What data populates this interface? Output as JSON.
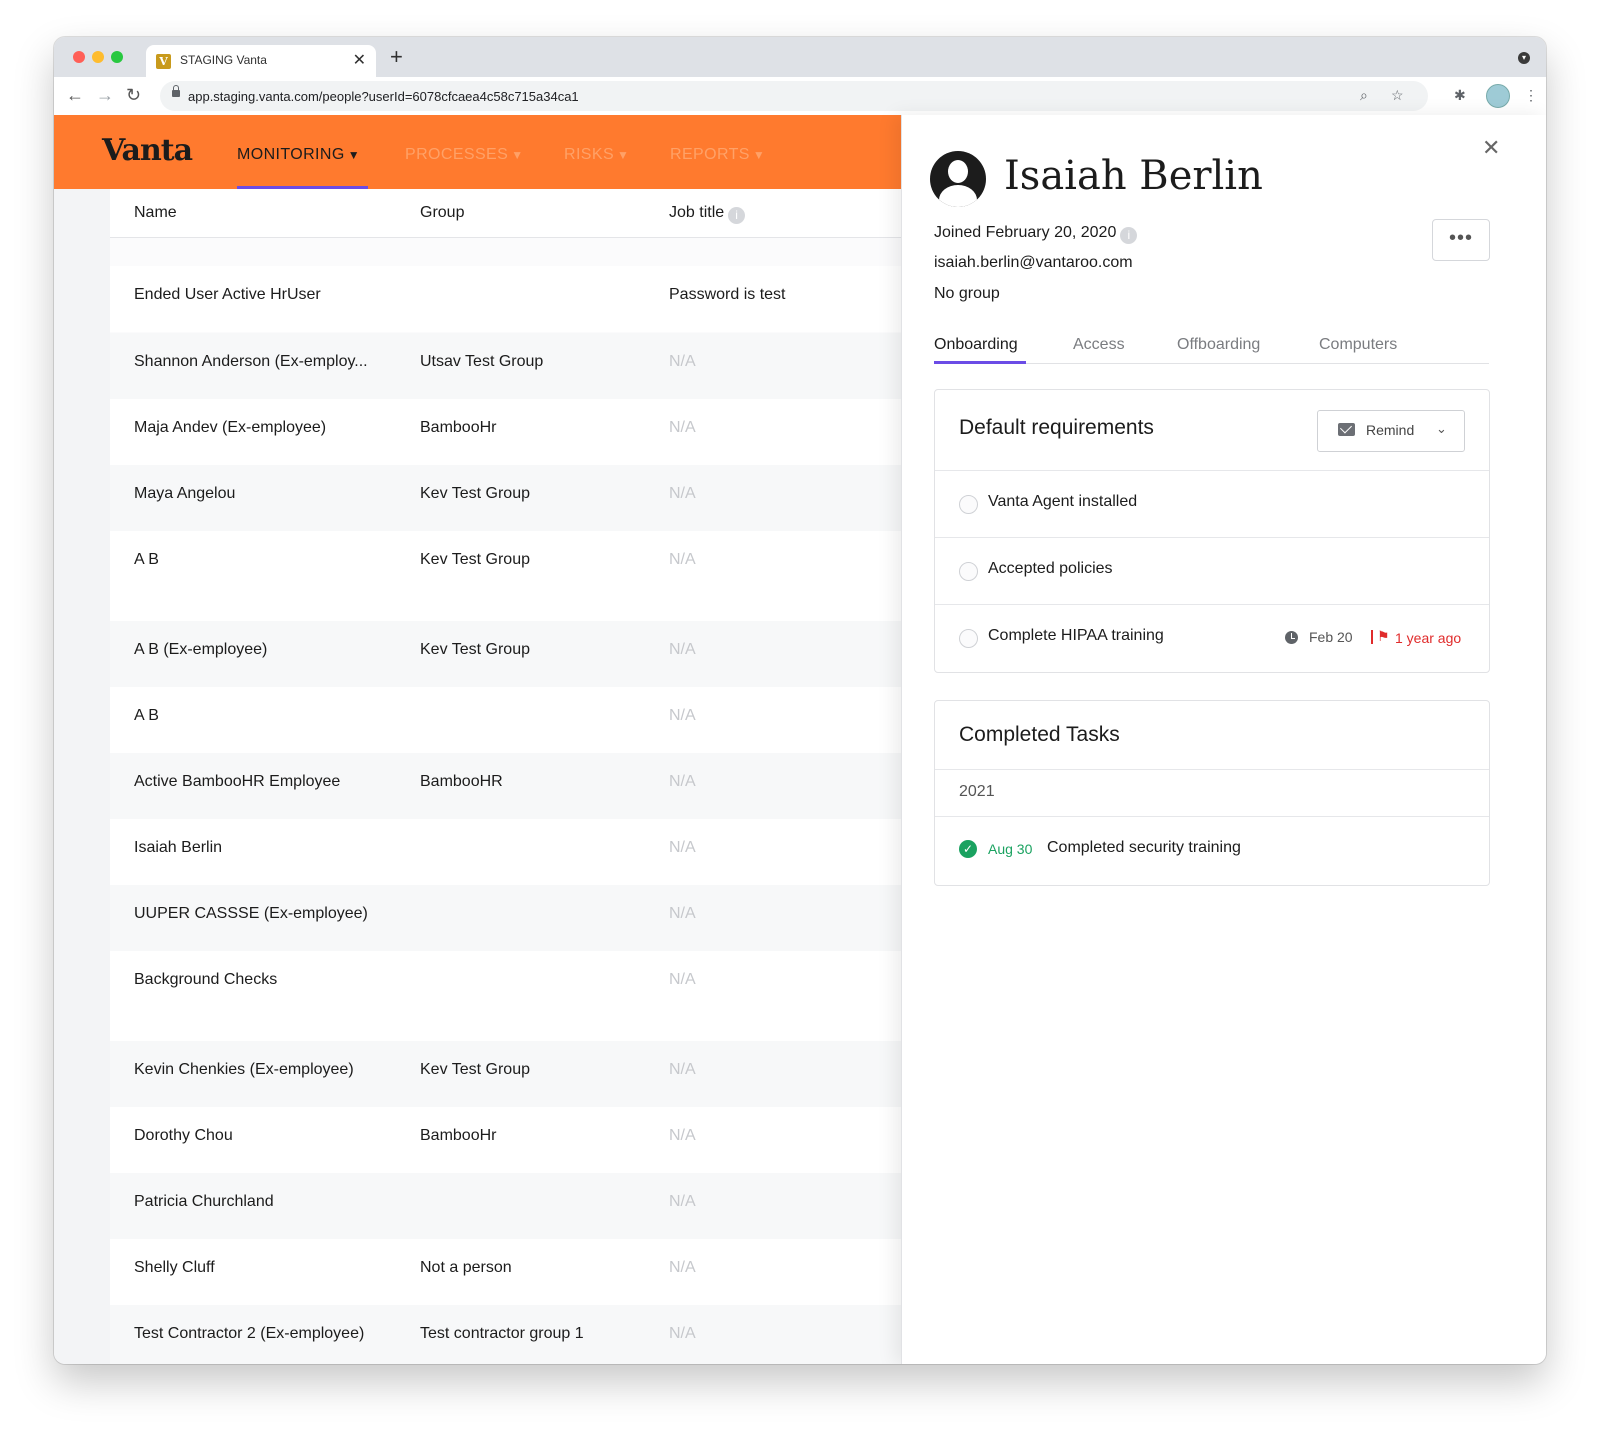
{
  "browser": {
    "tab_title": "STAGING Vanta",
    "favicon_letter": "V",
    "url": "app.staging.vanta.com/people?userId=6078cfcaea4c58c715a34ca1",
    "traffic_lights": [
      "#ff5f57",
      "#febc2e",
      "#28c840"
    ]
  },
  "topnav": {
    "logo": "Vanta",
    "items": [
      {
        "label": "MONITORING",
        "active": true,
        "color": "#1c1c1c"
      },
      {
        "label": "PROCESSES",
        "active": false,
        "color": "#ffa167"
      },
      {
        "label": "RISKS",
        "active": false,
        "color": "#ffa167"
      },
      {
        "label": "REPORTS",
        "active": false,
        "color": "#ffa167"
      }
    ],
    "background": "#ff7a2e",
    "accent": "#6b4ce6"
  },
  "table": {
    "headers": {
      "name": "Name",
      "group": "Group",
      "job_title": "Job title"
    },
    "rows": [
      {
        "name": "Ended User Active HrUser",
        "group": "",
        "job_title": "Password is test",
        "na": false
      },
      {
        "name": "Shannon Anderson (Ex-employ...",
        "group": "Utsav Test Group",
        "job_title": "N/A",
        "na": true
      },
      {
        "name": "Maja Andev (Ex-employee)",
        "group": "BambooHr",
        "job_title": "N/A",
        "na": true
      },
      {
        "name": "Maya Angelou",
        "group": "Kev Test Group",
        "job_title": "N/A",
        "na": true
      },
      {
        "name": "A B",
        "group": "Kev Test Group",
        "job_title": "N/A",
        "na": true
      },
      {
        "name": "A B (Ex-employee)",
        "group": "Kev Test Group",
        "job_title": "N/A",
        "na": true
      },
      {
        "name": "A B",
        "group": "",
        "job_title": "N/A",
        "na": true
      },
      {
        "name": "Active BambooHR Employee",
        "group": "BambooHR",
        "job_title": "N/A",
        "na": true
      },
      {
        "name": "Isaiah Berlin",
        "group": "",
        "job_title": "N/A",
        "na": true
      },
      {
        "name": "UUPER CASSSE (Ex-employee)",
        "group": "",
        "job_title": "N/A",
        "na": true
      },
      {
        "name": "Background Checks",
        "group": "",
        "job_title": "N/A",
        "na": true
      },
      {
        "name": "Kevin Chenkies (Ex-employee)",
        "group": "Kev Test Group",
        "job_title": "N/A",
        "na": true
      },
      {
        "name": "Dorothy Chou",
        "group": "BambooHr",
        "job_title": "N/A",
        "na": true
      },
      {
        "name": "Patricia Churchland",
        "group": "",
        "job_title": "N/A",
        "na": true
      },
      {
        "name": "Shelly Cluff",
        "group": "Not a person",
        "job_title": "N/A",
        "na": true
      },
      {
        "name": "Test Contractor 2 (Ex-employee)",
        "group": "Test contractor group 1",
        "job_title": "N/A",
        "na": true
      }
    ]
  },
  "panel": {
    "name": "Isaiah Berlin",
    "joined": "Joined February 20, 2020",
    "email": "isaiah.berlin@vantaroo.com",
    "group": "No group",
    "more": "•••",
    "close": "✕",
    "tabs": [
      {
        "label": "Onboarding",
        "active": true
      },
      {
        "label": "Access",
        "active": false
      },
      {
        "label": "Offboarding",
        "active": false
      },
      {
        "label": "Computers",
        "active": false
      }
    ],
    "requirements": {
      "title": "Default requirements",
      "remind_label": "Remind",
      "items": [
        {
          "label": "Vanta Agent installed"
        },
        {
          "label": "Accepted policies"
        },
        {
          "label": "Complete HIPAA training",
          "due": "Feb 20",
          "overdue": "1 year ago"
        }
      ]
    },
    "completed": {
      "title": "Completed Tasks",
      "year": "2021",
      "tasks": [
        {
          "date": "Aug 30",
          "label": "Completed security training"
        }
      ]
    }
  }
}
